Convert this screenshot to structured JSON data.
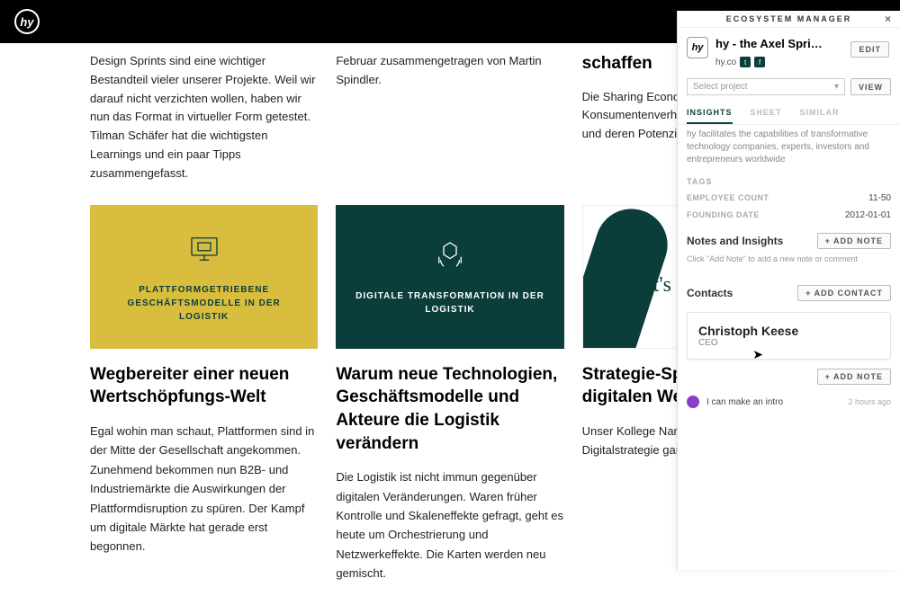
{
  "logo_text": "hy",
  "top_articles": [
    {
      "body": "Design Sprints sind eine wichtiger Bestandteil vieler unserer Projekte. Weil wir darauf nicht verzichten wollen, haben wir nun das Format in virtueller Form getestet. Tilman Schäfer hat die wichtigsten Learnings und ein paar Tipps zusammengefasst."
    },
    {
      "body": "Februar zusammengetragen von Martin Spindler."
    },
    {
      "title_frag": "schaffen",
      "body": "Die Sharing Economy Konsumentenverhalten in Industriemärkten und deren Potenziale."
    }
  ],
  "cards": [
    {
      "caption": "PLATTFORMGETRIEBENE GESCHÄFTSMODELLE IN DER LOGISTIK",
      "title": "Wegbereiter einer neuen Wertschöpfungs-Welt",
      "body": "Egal wohin man schaut, Plattformen sind in der Mitte der Gesellschaft angekommen. Zunehmend bekommen nun B2B- und Industriemärkte die Auswirkungen der Plattformdisruption zu spüren. Der Kampf um digitale Märkte hat gerade erst begonnen."
    },
    {
      "caption": "DIGITALE TRANSFORMATION IN DER LOGISTIK",
      "title": "Warum neue Technologien, Geschäftsmodelle und Akteure die Logistik verändern",
      "body": "Die Logistik ist nicht immun gegenüber digitalen Veränderungen. Waren früher Kontrolle und Skaleneffekte gefragt, geht es heute um Orchestrierung und Netzwerkeffekte. Die Karten werden neu gemischt."
    },
    {
      "white_text": "It's",
      "title": "Strategie-Sprint für die digitalen Welt",
      "body": "Unser Kollege Narrative bei der Digitalstrategie ganz konkret U"
    }
  ],
  "panel": {
    "header": "ECOSYSTEM MANAGER",
    "name": "hy - the Axel Spri…",
    "avatar_text": "hy",
    "domain": "hy.co",
    "edit": "EDIT",
    "select_placeholder": "Select project",
    "view": "VIEW",
    "tabs": {
      "insights": "INSIGHTS",
      "sheet": "SHEET",
      "similar": "SIMILAR"
    },
    "desc": "hy facilitates the capabilities of transformative technology companies, experts, investors and entrepreneurs worldwide",
    "tags_label": "TAGS",
    "employee_count_label": "EMPLOYEE COUNT",
    "employee_count": "11-50",
    "founding_label": "FOUNDING DATE",
    "founding": "2012-01-01",
    "notes_title": "Notes and Insights",
    "add_note": "+ ADD NOTE",
    "notes_hint": "Click \"Add Note\" to add a new note or comment",
    "contacts_title": "Contacts",
    "add_contact": "+ ADD CONTACT",
    "contact_name": "Christoph Keese",
    "contact_role": "CEO",
    "note_text": "I can make an intro",
    "note_time": "2 hours ago"
  }
}
